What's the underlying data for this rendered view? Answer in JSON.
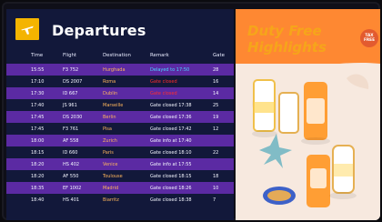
{
  "board": {
    "title": "Departures",
    "columns": {
      "time": "Time",
      "flight": "Flight",
      "destination": "Destination",
      "remark": "Remark",
      "gate": "Gate"
    },
    "rows": [
      {
        "time": "15:55",
        "flight": "F3 752",
        "destination": "Hurghada",
        "remark": "Delayed to 17:50",
        "gate": "28",
        "band": "purple",
        "dest_color": "#ffb65c",
        "remark_color": "#49d6ff"
      },
      {
        "time": "17:10",
        "flight": "DS 2007",
        "destination": "Roma",
        "remark": "Gate closed",
        "gate": "16",
        "band": "navy",
        "dest_color": "#ffb65c",
        "remark_color": "#ff2d2d"
      },
      {
        "time": "17:30",
        "flight": "ID 667",
        "destination": "Dublin",
        "remark": "Gate closed",
        "gate": "14",
        "band": "purple",
        "dest_color": "#ffb65c",
        "remark_color": "#ff2d2d"
      },
      {
        "time": "17:40",
        "flight": "JS 961",
        "destination": "Marseille",
        "remark": "Gate closed 17:38",
        "gate": "25",
        "band": "navy",
        "dest_color": "#ffb65c",
        "remark_color": "#f4f6ff"
      },
      {
        "time": "17:45",
        "flight": "DS 2030",
        "destination": "Berlin",
        "remark": "Gate closed 17:36",
        "gate": "19",
        "band": "purple",
        "dest_color": "#ffb65c",
        "remark_color": "#f4f6ff"
      },
      {
        "time": "17:45",
        "flight": "F3 761",
        "destination": "Pisa",
        "remark": "Gate closed 17:42",
        "gate": "12",
        "band": "navy",
        "dest_color": "#ffb65c",
        "remark_color": "#f4f6ff"
      },
      {
        "time": "18:00",
        "flight": "AF 558",
        "destination": "Zurich",
        "remark": "Gate info at 17:40",
        "gate": "",
        "band": "purple",
        "dest_color": "#ffb65c",
        "remark_color": "#f4f6ff"
      },
      {
        "time": "18:15",
        "flight": "ID 660",
        "destination": "Paris",
        "remark": "Gate closed 18:10",
        "gate": "22",
        "band": "navy",
        "dest_color": "#ffb65c",
        "remark_color": "#f4f6ff"
      },
      {
        "time": "18:20",
        "flight": "HS 402",
        "destination": "Venice",
        "remark": "Gate info at 17:55",
        "gate": "",
        "band": "purple",
        "dest_color": "#ffb65c",
        "remark_color": "#f4f6ff"
      },
      {
        "time": "18:20",
        "flight": "AF 550",
        "destination": "Toulouse",
        "remark": "Gate closed 18:15",
        "gate": "18",
        "band": "navy",
        "dest_color": "#ffb65c",
        "remark_color": "#f4f6ff"
      },
      {
        "time": "18:35",
        "flight": "EF 1002",
        "destination": "Madrid",
        "remark": "Gate closed 18:26",
        "gate": "10",
        "band": "purple",
        "dest_color": "#ffb65c",
        "remark_color": "#f4f6ff"
      },
      {
        "time": "18:40",
        "flight": "HS 401",
        "destination": "Biarritz",
        "remark": "Gate closed 18:38",
        "gate": "7",
        "band": "navy",
        "dest_color": "#ffb65c",
        "remark_color": "#f4f6ff"
      }
    ],
    "colors": {
      "purple_row": "#5b2aa3",
      "navy_row": "#12183a",
      "logo": "#f4b400"
    }
  },
  "promo": {
    "headline_line1": "Duty Free",
    "headline_line2": "Highlights",
    "badge_line1": "TAX",
    "badge_line2": "FREE",
    "colors": {
      "headline": "#f6a51a",
      "badge": "#e35b2f",
      "background": "#f7e9df"
    }
  },
  "icons": {
    "airline_logo": "airplane-icon"
  }
}
